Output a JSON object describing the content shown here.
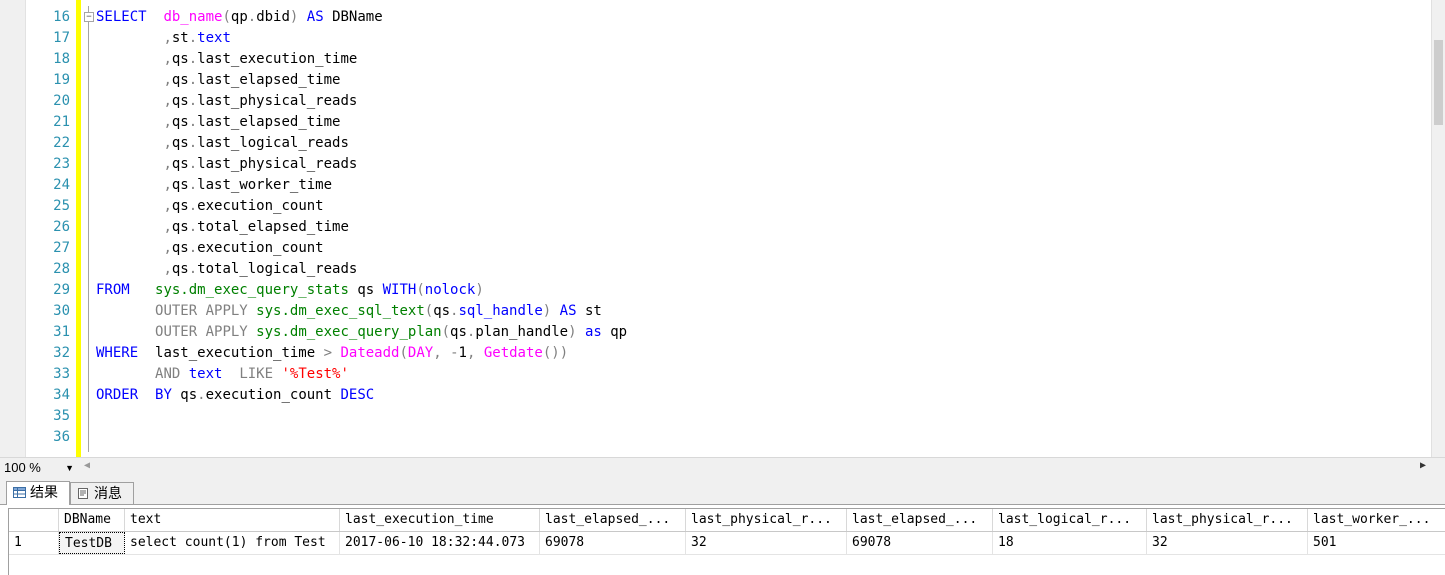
{
  "editor": {
    "line_numbers": [
      "16",
      "17",
      "18",
      "19",
      "20",
      "21",
      "22",
      "23",
      "24",
      "25",
      "26",
      "27",
      "28",
      "29",
      "30",
      "31",
      "32",
      "33",
      "34",
      "35",
      "36"
    ],
    "lines": [
      {
        "segments": [
          {
            "t": "SELECT",
            "c": "kw"
          },
          {
            "t": "  ",
            "c": ""
          },
          {
            "t": "db_name",
            "c": "fn"
          },
          {
            "t": "(",
            "c": "gray"
          },
          {
            "t": "qp",
            "c": ""
          },
          {
            "t": ".",
            "c": "gray"
          },
          {
            "t": "dbid",
            "c": ""
          },
          {
            "t": ")",
            "c": "gray"
          },
          {
            "t": " ",
            "c": ""
          },
          {
            "t": "AS",
            "c": "kw"
          },
          {
            "t": " DBName",
            "c": ""
          }
        ]
      },
      {
        "segments": [
          {
            "t": "        ",
            "c": ""
          },
          {
            "t": ",",
            "c": "gray"
          },
          {
            "t": "st",
            "c": ""
          },
          {
            "t": ".",
            "c": "gray"
          },
          {
            "t": "text",
            "c": "kw"
          }
        ]
      },
      {
        "segments": [
          {
            "t": "        ",
            "c": ""
          },
          {
            "t": ",",
            "c": "gray"
          },
          {
            "t": "qs",
            "c": ""
          },
          {
            "t": ".",
            "c": "gray"
          },
          {
            "t": "last_execution_time",
            "c": ""
          }
        ]
      },
      {
        "segments": [
          {
            "t": "        ",
            "c": ""
          },
          {
            "t": ",",
            "c": "gray"
          },
          {
            "t": "qs",
            "c": ""
          },
          {
            "t": ".",
            "c": "gray"
          },
          {
            "t": "last_elapsed_time",
            "c": ""
          }
        ]
      },
      {
        "segments": [
          {
            "t": "        ",
            "c": ""
          },
          {
            "t": ",",
            "c": "gray"
          },
          {
            "t": "qs",
            "c": ""
          },
          {
            "t": ".",
            "c": "gray"
          },
          {
            "t": "last_physical_reads",
            "c": ""
          }
        ]
      },
      {
        "segments": [
          {
            "t": "        ",
            "c": ""
          },
          {
            "t": ",",
            "c": "gray"
          },
          {
            "t": "qs",
            "c": ""
          },
          {
            "t": ".",
            "c": "gray"
          },
          {
            "t": "last_elapsed_time",
            "c": ""
          }
        ]
      },
      {
        "segments": [
          {
            "t": "        ",
            "c": ""
          },
          {
            "t": ",",
            "c": "gray"
          },
          {
            "t": "qs",
            "c": ""
          },
          {
            "t": ".",
            "c": "gray"
          },
          {
            "t": "last_logical_reads",
            "c": ""
          }
        ]
      },
      {
        "segments": [
          {
            "t": "        ",
            "c": ""
          },
          {
            "t": ",",
            "c": "gray"
          },
          {
            "t": "qs",
            "c": ""
          },
          {
            "t": ".",
            "c": "gray"
          },
          {
            "t": "last_physical_reads",
            "c": ""
          }
        ]
      },
      {
        "segments": [
          {
            "t": "        ",
            "c": ""
          },
          {
            "t": ",",
            "c": "gray"
          },
          {
            "t": "qs",
            "c": ""
          },
          {
            "t": ".",
            "c": "gray"
          },
          {
            "t": "last_worker_time",
            "c": ""
          }
        ]
      },
      {
        "segments": [
          {
            "t": "        ",
            "c": ""
          },
          {
            "t": ",",
            "c": "gray"
          },
          {
            "t": "qs",
            "c": ""
          },
          {
            "t": ".",
            "c": "gray"
          },
          {
            "t": "execution_count",
            "c": ""
          }
        ]
      },
      {
        "segments": [
          {
            "t": "        ",
            "c": ""
          },
          {
            "t": ",",
            "c": "gray"
          },
          {
            "t": "qs",
            "c": ""
          },
          {
            "t": ".",
            "c": "gray"
          },
          {
            "t": "total_elapsed_time",
            "c": ""
          }
        ]
      },
      {
        "segments": [
          {
            "t": "        ",
            "c": ""
          },
          {
            "t": ",",
            "c": "gray"
          },
          {
            "t": "qs",
            "c": ""
          },
          {
            "t": ".",
            "c": "gray"
          },
          {
            "t": "execution_count",
            "c": ""
          }
        ]
      },
      {
        "segments": [
          {
            "t": "        ",
            "c": ""
          },
          {
            "t": ",",
            "c": "gray"
          },
          {
            "t": "qs",
            "c": ""
          },
          {
            "t": ".",
            "c": "gray"
          },
          {
            "t": "total_logical_reads",
            "c": ""
          }
        ]
      },
      {
        "segments": [
          {
            "t": "FROM",
            "c": "kw"
          },
          {
            "t": "   ",
            "c": ""
          },
          {
            "t": "sys.dm_exec_query_stats",
            "c": "sys"
          },
          {
            "t": " qs ",
            "c": ""
          },
          {
            "t": "WITH",
            "c": "kw"
          },
          {
            "t": "(",
            "c": "gray"
          },
          {
            "t": "nolock",
            "c": "kw"
          },
          {
            "t": ")",
            "c": "gray"
          }
        ]
      },
      {
        "segments": [
          {
            "t": "       ",
            "c": ""
          },
          {
            "t": "OUTER APPLY",
            "c": "gray"
          },
          {
            "t": " ",
            "c": ""
          },
          {
            "t": "sys.dm_exec_sql_text",
            "c": "sys"
          },
          {
            "t": "(",
            "c": "gray"
          },
          {
            "t": "qs",
            "c": ""
          },
          {
            "t": ".",
            "c": "gray"
          },
          {
            "t": "sql_handle",
            "c": "kw"
          },
          {
            "t": ")",
            "c": "gray"
          },
          {
            "t": " ",
            "c": ""
          },
          {
            "t": "AS",
            "c": "kw"
          },
          {
            "t": " st",
            "c": ""
          }
        ]
      },
      {
        "segments": [
          {
            "t": "       ",
            "c": ""
          },
          {
            "t": "OUTER APPLY",
            "c": "gray"
          },
          {
            "t": " ",
            "c": ""
          },
          {
            "t": "sys.dm_exec_query_plan",
            "c": "sys"
          },
          {
            "t": "(",
            "c": "gray"
          },
          {
            "t": "qs",
            "c": ""
          },
          {
            "t": ".",
            "c": "gray"
          },
          {
            "t": "plan_handle",
            "c": ""
          },
          {
            "t": ")",
            "c": "gray"
          },
          {
            "t": " ",
            "c": ""
          },
          {
            "t": "as",
            "c": "kw"
          },
          {
            "t": " qp",
            "c": ""
          }
        ]
      },
      {
        "segments": [
          {
            "t": "WHERE",
            "c": "kw"
          },
          {
            "t": "  last_execution_time ",
            "c": ""
          },
          {
            "t": ">",
            "c": "gray"
          },
          {
            "t": " ",
            "c": ""
          },
          {
            "t": "Dateadd",
            "c": "fn"
          },
          {
            "t": "(",
            "c": "gray"
          },
          {
            "t": "DAY",
            "c": "fn"
          },
          {
            "t": ",",
            "c": "gray"
          },
          {
            "t": " ",
            "c": ""
          },
          {
            "t": "-",
            "c": "gray"
          },
          {
            "t": "1",
            "c": ""
          },
          {
            "t": ",",
            "c": "gray"
          },
          {
            "t": " ",
            "c": ""
          },
          {
            "t": "Getdate",
            "c": "fn"
          },
          {
            "t": "())",
            "c": "gray"
          }
        ]
      },
      {
        "segments": [
          {
            "t": "       ",
            "c": ""
          },
          {
            "t": "AND",
            "c": "gray"
          },
          {
            "t": " ",
            "c": ""
          },
          {
            "t": "text",
            "c": "kw"
          },
          {
            "t": "  ",
            "c": ""
          },
          {
            "t": "LIKE",
            "c": "gray"
          },
          {
            "t": " ",
            "c": ""
          },
          {
            "t": "'%Test%'",
            "c": "str"
          }
        ]
      },
      {
        "segments": [
          {
            "t": "ORDER",
            "c": "kw"
          },
          {
            "t": "  ",
            "c": ""
          },
          {
            "t": "BY",
            "c": "kw"
          },
          {
            "t": " qs",
            "c": ""
          },
          {
            "t": ".",
            "c": "gray"
          },
          {
            "t": "execution_count ",
            "c": ""
          },
          {
            "t": "DESC",
            "c": "kw"
          }
        ]
      },
      {
        "segments": []
      },
      {
        "segments": []
      }
    ]
  },
  "status": {
    "zoom": "100 %"
  },
  "tabs": [
    {
      "label": "结果",
      "icon": "grid-icon"
    },
    {
      "label": "消息",
      "icon": "message-icon"
    }
  ],
  "grid": {
    "columns": [
      "DBName",
      "text",
      "last_execution_time",
      "last_elapsed_...",
      "last_physical_r...",
      "last_elapsed_...",
      "last_logical_r...",
      "last_physical_r...",
      "last_worker_..."
    ],
    "rows": [
      {
        "num": "1",
        "cells": [
          "TestDB",
          "select count(1) from Test",
          "2017-06-10 18:32:44.073",
          "69078",
          "32",
          "69078",
          "18",
          "32",
          "501"
        ]
      }
    ]
  }
}
